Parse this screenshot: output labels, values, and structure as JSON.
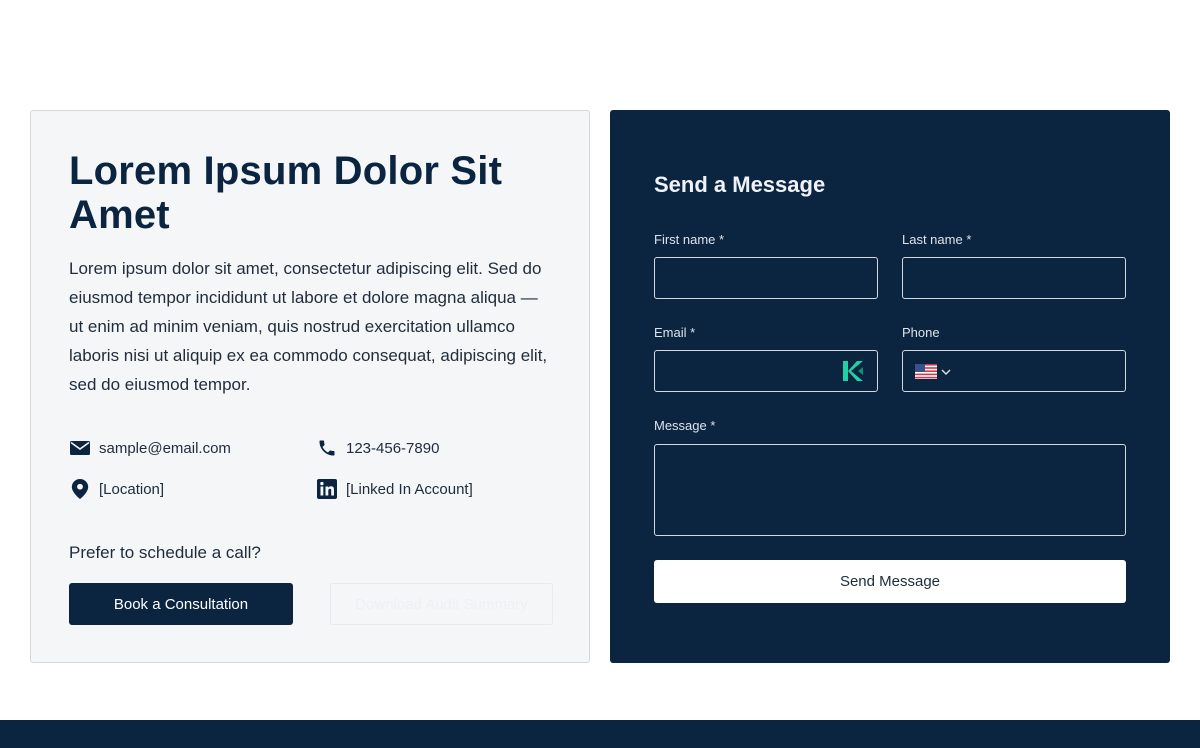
{
  "info": {
    "title": "Lorem Ipsum Dolor Sit Amet",
    "description": "Lorem ipsum dolor sit amet, consectetur adipiscing elit. Sed do eiusmod tempor incididunt ut labore et dolore magna aliqua — ut enim ad minim veniam, quis nostrud exercitation ullamco laboris nisi ut aliquip ex ea commodo consequat, adipiscing elit, sed do eiusmod tempor.",
    "contacts": {
      "email": "sample@email.com",
      "phone": "123-456-7890",
      "location": "[Location]",
      "linkedin": "[Linked In Account]"
    },
    "schedule_prompt": "Prefer to schedule a call?",
    "consult_button": "Book a Consultation",
    "download_button": "Download Audit Summary"
  },
  "form": {
    "title": "Send a Message",
    "first_name_label": "First name *",
    "last_name_label": "Last name *",
    "email_label": "Email *",
    "phone_label": "Phone",
    "message_label": "Message *",
    "submit_label": "Send Message"
  },
  "colors": {
    "navy": "#0b2440",
    "card_bg": "#f5f6f8",
    "accent_teal": "#1fd1a6"
  },
  "icons": {
    "email": "envelope-icon",
    "phone": "phone-icon",
    "location": "map-pin-icon",
    "linkedin": "linkedin-icon",
    "autofill": "autofill-icon",
    "flag": "us-flag-icon"
  }
}
